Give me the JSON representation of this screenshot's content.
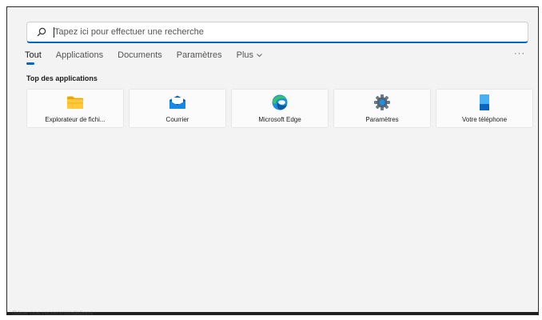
{
  "search": {
    "placeholder": "Tapez ici pour effectuer une recherche"
  },
  "tabs": [
    {
      "label": "Tout"
    },
    {
      "label": "Applications"
    },
    {
      "label": "Documents"
    },
    {
      "label": "Paramètres"
    },
    {
      "label": "Plus"
    }
  ],
  "more_menu": "···",
  "top_apps": {
    "title": "Top des applications",
    "items": [
      {
        "label": "Explorateur de fichi...",
        "icon": "folder-icon"
      },
      {
        "label": "Courrier",
        "icon": "mail-icon"
      },
      {
        "label": "Microsoft Edge",
        "icon": "edge-icon"
      },
      {
        "label": "Paramètres",
        "icon": "settings-gear-icon"
      },
      {
        "label": "Votre téléphone",
        "icon": "phone-icon"
      }
    ]
  },
  "bottom_hint": "Gérer nos recommandations",
  "colors": {
    "accent": "#0067c0",
    "panel_bg": "#f3f3f3"
  }
}
